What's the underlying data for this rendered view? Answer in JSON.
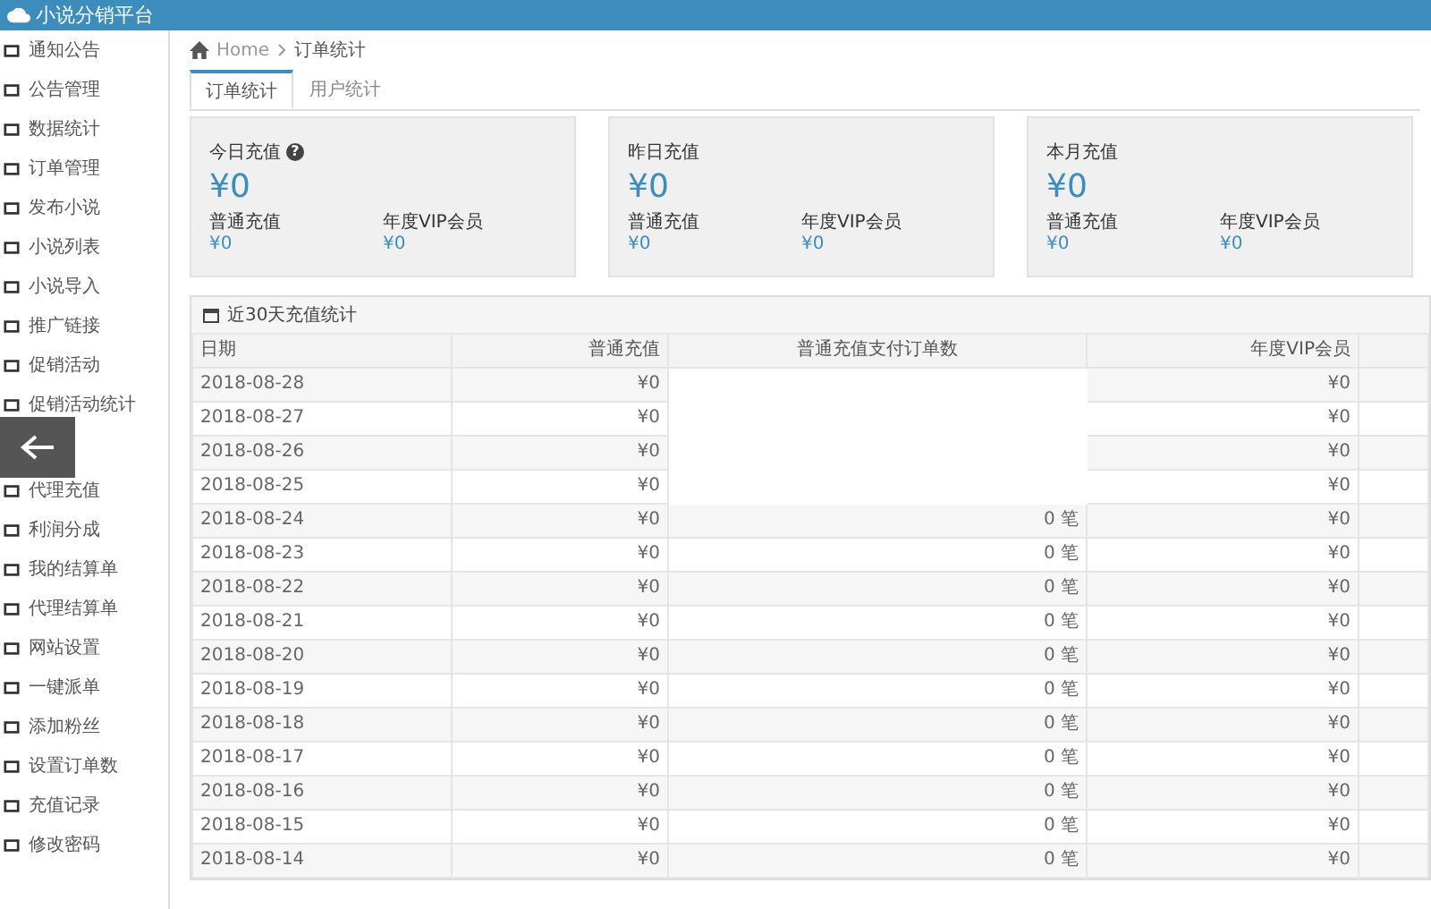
{
  "header": {
    "title": "小说分销平台"
  },
  "sidebar": {
    "items": [
      {
        "label": "通知公告"
      },
      {
        "label": "公告管理"
      },
      {
        "label": "数据统计"
      },
      {
        "label": "订单管理"
      },
      {
        "label": "发布小说"
      },
      {
        "label": "小说列表"
      },
      {
        "label": "小说导入"
      },
      {
        "label": "推广链接"
      },
      {
        "label": "促销活动"
      },
      {
        "label": "促销活动统计"
      },
      {
        "label": "代理充值"
      },
      {
        "label": "利润分成"
      },
      {
        "label": "我的结算单"
      },
      {
        "label": "代理结算单"
      },
      {
        "label": "网站设置"
      },
      {
        "label": "一键派单"
      },
      {
        "label": "添加粉丝"
      },
      {
        "label": "设置订单数"
      },
      {
        "label": "充值记录"
      },
      {
        "label": "修改密码"
      }
    ]
  },
  "breadcrumb": [
    "Home",
    "订单统计"
  ],
  "tabs": [
    {
      "label": "订单统计",
      "selected": true
    },
    {
      "label": "用户统计",
      "selected": false
    }
  ],
  "stat_cards": [
    {
      "title": "今日充值",
      "help": "?",
      "amount": "¥0",
      "sub": [
        {
          "label": "普通充值",
          "value": "¥0"
        },
        {
          "label": "年度VIP会员",
          "value": "¥0"
        }
      ]
    },
    {
      "title": "昨日充值",
      "amount": "¥0",
      "sub": [
        {
          "label": "普通充值",
          "value": "¥0"
        },
        {
          "label": "年度VIP会员",
          "value": "¥0"
        }
      ]
    },
    {
      "title": "本月充值",
      "amount": "¥0",
      "sub": [
        {
          "label": "普通充值",
          "value": "¥0"
        },
        {
          "label": "年度VIP会员",
          "value": "¥0"
        }
      ]
    }
  ],
  "table": {
    "title": "近30天充值统计",
    "columns": [
      "日期",
      "普通充值",
      "普通充值支付订单数",
      "年度VIP会员"
    ],
    "rows": [
      {
        "date": "2018-08-28",
        "normal": "¥0",
        "vip": "¥0"
      },
      {
        "date": "2018-08-27",
        "normal": "¥0",
        "vip": "¥0"
      },
      {
        "date": "2018-08-26",
        "normal": "¥0",
        "vip": "¥0"
      },
      {
        "date": "2018-08-25",
        "normal": "¥0",
        "vip": "¥0"
      },
      {
        "date": "2018-08-24",
        "normal": "¥0",
        "orders": "0 笔",
        "vip": "¥0"
      },
      {
        "date": "2018-08-23",
        "normal": "¥0",
        "orders": "0 笔",
        "vip": "¥0"
      },
      {
        "date": "2018-08-22",
        "normal": "¥0",
        "orders": "0 笔",
        "vip": "¥0"
      },
      {
        "date": "2018-08-21",
        "normal": "¥0",
        "orders": "0 笔",
        "vip": "¥0"
      },
      {
        "date": "2018-08-20",
        "normal": "¥0",
        "orders": "0 笔",
        "vip": "¥0"
      },
      {
        "date": "2018-08-19",
        "normal": "¥0",
        "orders": "0 笔",
        "vip": "¥0"
      },
      {
        "date": "2018-08-18",
        "normal": "¥0",
        "orders": "0 笔",
        "vip": "¥0"
      },
      {
        "date": "2018-08-17",
        "normal": "¥0",
        "orders": "0 笔",
        "vip": "¥0"
      },
      {
        "date": "2018-08-16",
        "normal": "¥0",
        "orders": "0 笔",
        "vip": "¥0"
      },
      {
        "date": "2018-08-15",
        "normal": "¥0",
        "orders": "0 笔",
        "vip": "¥0"
      },
      {
        "date": "2018-08-14",
        "normal": "¥0",
        "orders": "0 笔",
        "vip": "¥0"
      }
    ]
  }
}
